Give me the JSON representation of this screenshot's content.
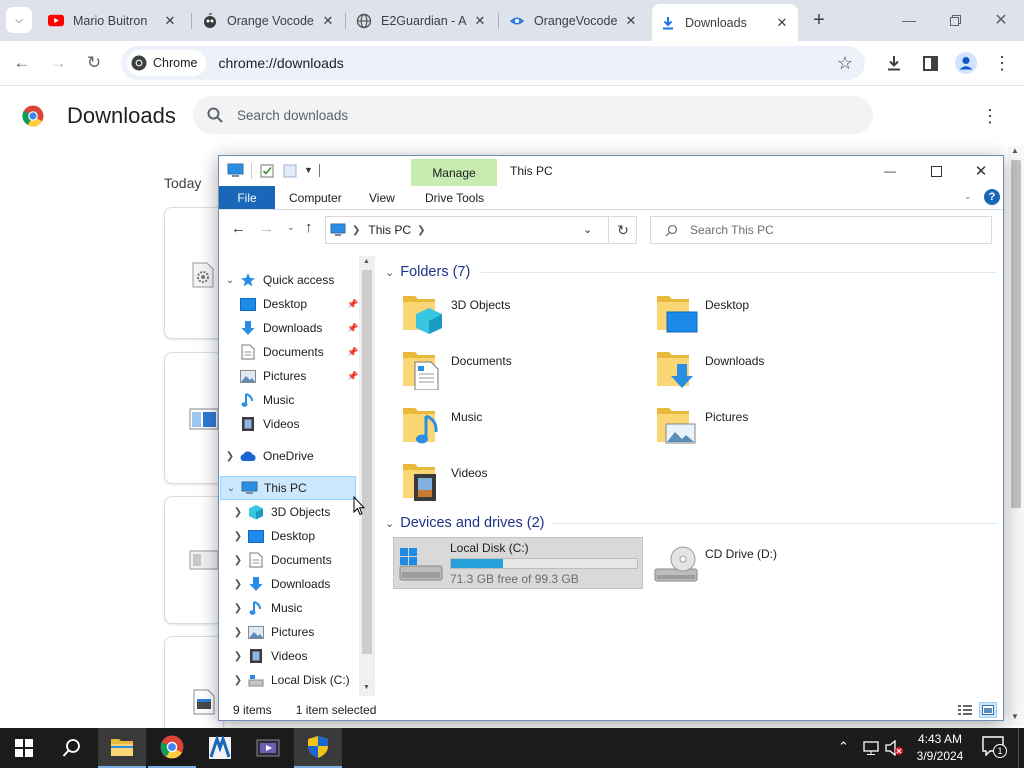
{
  "browser": {
    "tabs": [
      {
        "label": "Mario Buitron",
        "icon": "youtube-icon"
      },
      {
        "label": "Orange Vocode",
        "icon": "orange-icon"
      },
      {
        "label": "E2Guardian - A",
        "icon": "globe-icon"
      },
      {
        "label": "OrangeVocode",
        "icon": "orange-vocoder-icon"
      },
      {
        "label": "Downloads",
        "icon": "download-icon",
        "active": true
      }
    ],
    "chip_label": "Chrome",
    "url": "chrome://downloads"
  },
  "downloads_page": {
    "title": "Downloads",
    "search_placeholder": "Search downloads",
    "section_today": "Today"
  },
  "explorer": {
    "title": "This PC",
    "manage_tab": "Manage",
    "ribbon_tabs": [
      "File",
      "Computer",
      "View",
      "Drive Tools"
    ],
    "address_path": "This PC",
    "search_placeholder": "Search This PC",
    "nav": {
      "quick_access": "Quick access",
      "quick_items": [
        "Desktop",
        "Downloads",
        "Documents",
        "Pictures",
        "Music",
        "Videos"
      ],
      "onedrive": "OneDrive",
      "this_pc": "This PC",
      "pc_items": [
        "3D Objects",
        "Desktop",
        "Documents",
        "Downloads",
        "Music",
        "Pictures",
        "Videos",
        "Local Disk (C:)"
      ]
    },
    "folders_header": "Folders (7)",
    "folders": [
      "3D Objects",
      "Desktop",
      "Documents",
      "Downloads",
      "Music",
      "Pictures",
      "Videos"
    ],
    "devices_header": "Devices and drives (2)",
    "drives": [
      {
        "name": "Local Disk (C:)",
        "free_text": "71.3 GB free of 99.3 GB",
        "used_fraction": 0.28
      },
      {
        "name": "CD Drive (D:)"
      }
    ],
    "status": {
      "items": "9 items",
      "selected": "1 item selected"
    }
  },
  "taskbar": {
    "time": "4:43 AM",
    "date": "3/9/2024",
    "notification_count": "1"
  },
  "colors": {
    "chrome_tabstrip": "#dee3eb",
    "file_tab": "#1a66b8",
    "manage_tab": "#c7ecb2",
    "drive_bar": "#26a0da",
    "taskbar": "#1b1b1b"
  }
}
